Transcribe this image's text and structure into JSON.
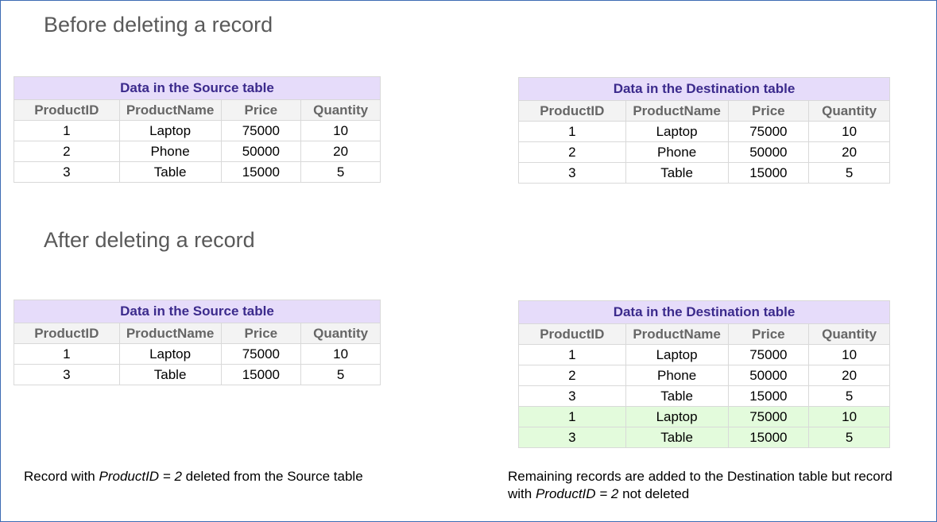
{
  "before": {
    "heading": "Before deleting a record",
    "source": {
      "title": "Data in the Source table",
      "columns": [
        "ProductID",
        "ProductName",
        "Price",
        "Quantity"
      ],
      "rows": [
        [
          "1",
          "Laptop",
          "75000",
          "10"
        ],
        [
          "2",
          "Phone",
          "50000",
          "20"
        ],
        [
          "3",
          "Table",
          "15000",
          "5"
        ]
      ]
    },
    "destination": {
      "title": "Data in the Destination table",
      "columns": [
        "ProductID",
        "ProductName",
        "Price",
        "Quantity"
      ],
      "rows": [
        [
          "1",
          "Laptop",
          "75000",
          "10"
        ],
        [
          "2",
          "Phone",
          "50000",
          "20"
        ],
        [
          "3",
          "Table",
          "15000",
          "5"
        ]
      ]
    }
  },
  "after": {
    "heading": "After deleting a record",
    "source": {
      "title": "Data in the Source table",
      "columns": [
        "ProductID",
        "ProductName",
        "Price",
        "Quantity"
      ],
      "rows": [
        [
          "1",
          "Laptop",
          "75000",
          "10"
        ],
        [
          "3",
          "Table",
          "15000",
          "5"
        ]
      ]
    },
    "destination": {
      "title": "Data in the Destination table",
      "columns": [
        "ProductID",
        "ProductName",
        "Price",
        "Quantity"
      ],
      "rows": [
        [
          "1",
          "Laptop",
          "75000",
          "10"
        ],
        [
          "2",
          "Phone",
          "50000",
          "20"
        ],
        [
          "3",
          "Table",
          "15000",
          "5"
        ],
        [
          "1",
          "Laptop",
          "75000",
          "10"
        ],
        [
          "3",
          "Table",
          "15000",
          "5"
        ]
      ],
      "highlighted_rows": [
        3,
        4
      ],
      "highlight_color": "#e3fbdc"
    }
  },
  "captions": {
    "left": {
      "prefix": "Record with ",
      "field": "ProductID = 2",
      "suffix": " deleted from the Source table"
    },
    "right": {
      "line1": "Remaining records are added to the Destination table but record",
      "prefix": "with ",
      "field": "ProductID = 2",
      "suffix": " not deleted"
    }
  },
  "colors": {
    "title_bg": "#e6dcfa",
    "title_text": "#3b2a8c",
    "header_bg": "#f3f3f3",
    "border": "#3d6bb3"
  }
}
